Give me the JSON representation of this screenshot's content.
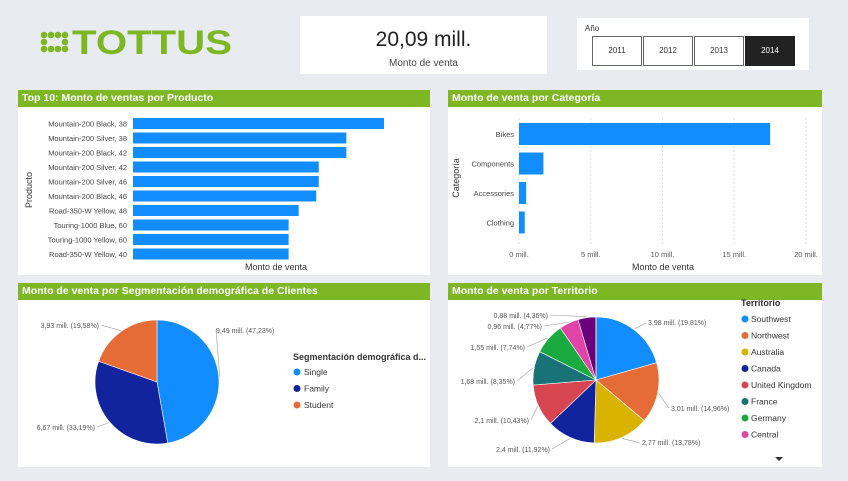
{
  "brand": {
    "name": "TOTTUS"
  },
  "kpi": {
    "value": "20,09 mill.",
    "label": "Monto de venta"
  },
  "year_slicer": {
    "title": "Año",
    "options": [
      "2011",
      "2012",
      "2013",
      "2014"
    ],
    "selected": "2014"
  },
  "colors": {
    "header_green": "#7db724",
    "bar_blue": "#118dff"
  },
  "top10": {
    "title": "Top 10: Monto de ventas por Producto",
    "ylabel": "Producto",
    "xlabel": "Monto de venta"
  },
  "categoria": {
    "title": "Monto de venta por Categoría",
    "ylabel": "Categoría",
    "xlabel": "Monto de venta"
  },
  "segmentacion": {
    "title": "Monto de venta por Segmentación demográfica de Clientes",
    "legend_title": "Segmentación demográfica d..."
  },
  "territorio": {
    "title": "Monto de venta por Territorio",
    "legend_title": "Territorio"
  },
  "chart_data": [
    {
      "type": "bar",
      "orientation": "horizontal",
      "categories": [
        "Mountain-200 Black, 38",
        "Mountain-200 Silver, 38",
        "Mountain-200 Black, 42",
        "Mountain-200 Silver, 42",
        "Mountain-200 Silver, 46",
        "Mountain-200 Black, 46",
        "Road-350-W Yellow, 48",
        "Touring-1000 Blue, 60",
        "Touring-1000 Yellow, 60",
        "Road-350-W Yellow, 40"
      ],
      "values": [
        1.0,
        0.85,
        0.85,
        0.74,
        0.74,
        0.73,
        0.66,
        0.62,
        0.62,
        0.62
      ],
      "value_scale": "relative to largest bar",
      "title": "Top 10: Monto de ventas por Producto",
      "xlabel": "Monto de venta",
      "ylabel": "Producto",
      "color": "#118dff"
    },
    {
      "type": "bar",
      "orientation": "horizontal",
      "categories": [
        "Bikes",
        "Components",
        "Accessories",
        "Clothing"
      ],
      "values": [
        17.5,
        1.7,
        0.5,
        0.4
      ],
      "title": "Monto de venta por Categoría",
      "xlabel": "Monto de venta",
      "ylabel": "Categoría",
      "xlim": [
        0,
        20
      ],
      "xticks": [
        "0 mill.",
        "5 mill.",
        "10 mill.",
        "15 mill.",
        "20 mill."
      ],
      "color": "#118dff"
    },
    {
      "type": "pie",
      "title": "Monto de venta por Segmentación demográfica de Clientes",
      "slices": [
        {
          "label": "Single",
          "value": 9.49,
          "text": "9,49 mill. (47,23%)",
          "color": "#118dff"
        },
        {
          "label": "Family",
          "value": 6.67,
          "text": "6,67 mill. (33,19%)",
          "color": "#12239e"
        },
        {
          "label": "Student",
          "value": 3.93,
          "text": "3,93 mill. (19,58%)",
          "color": "#e66c37"
        }
      ]
    },
    {
      "type": "pie",
      "title": "Monto de venta por Territorio",
      "slices": [
        {
          "label": "Southwest",
          "value": 3.98,
          "text": "3,98 mill. (19,81%)",
          "color": "#118dff"
        },
        {
          "label": "Northwest",
          "value": 3.01,
          "text": "3,01 mill. (14,96%)",
          "color": "#e66c37"
        },
        {
          "label": "Australia",
          "value": 2.77,
          "text": "2,77 mill. (13,78%)",
          "color": "#d9b300"
        },
        {
          "label": "Canada",
          "value": 2.4,
          "text": "2,4 mill. (11,92%)",
          "color": "#12239e"
        },
        {
          "label": "United Kingdom",
          "value": 2.1,
          "text": "2,1 mill. (10,43%)",
          "color": "#d64550"
        },
        {
          "label": "France",
          "value": 1.68,
          "text": "1,68 mill. (8,35%)",
          "color": "#197278"
        },
        {
          "label": "Germany",
          "value": 1.55,
          "text": "1,55 mill. (7,74%)",
          "color": "#1aab40"
        },
        {
          "label": "Central",
          "value": 0.96,
          "text": "0,96 mill. (4,77%)",
          "color": "#e044a7"
        },
        {
          "label": "",
          "value": 0.88,
          "text": "0,88 mill. (4,36%)",
          "color": "#6b007b"
        },
        {
          "label": "",
          "value": 0.01,
          "text": "",
          "color": "#744ec2"
        }
      ]
    }
  ]
}
